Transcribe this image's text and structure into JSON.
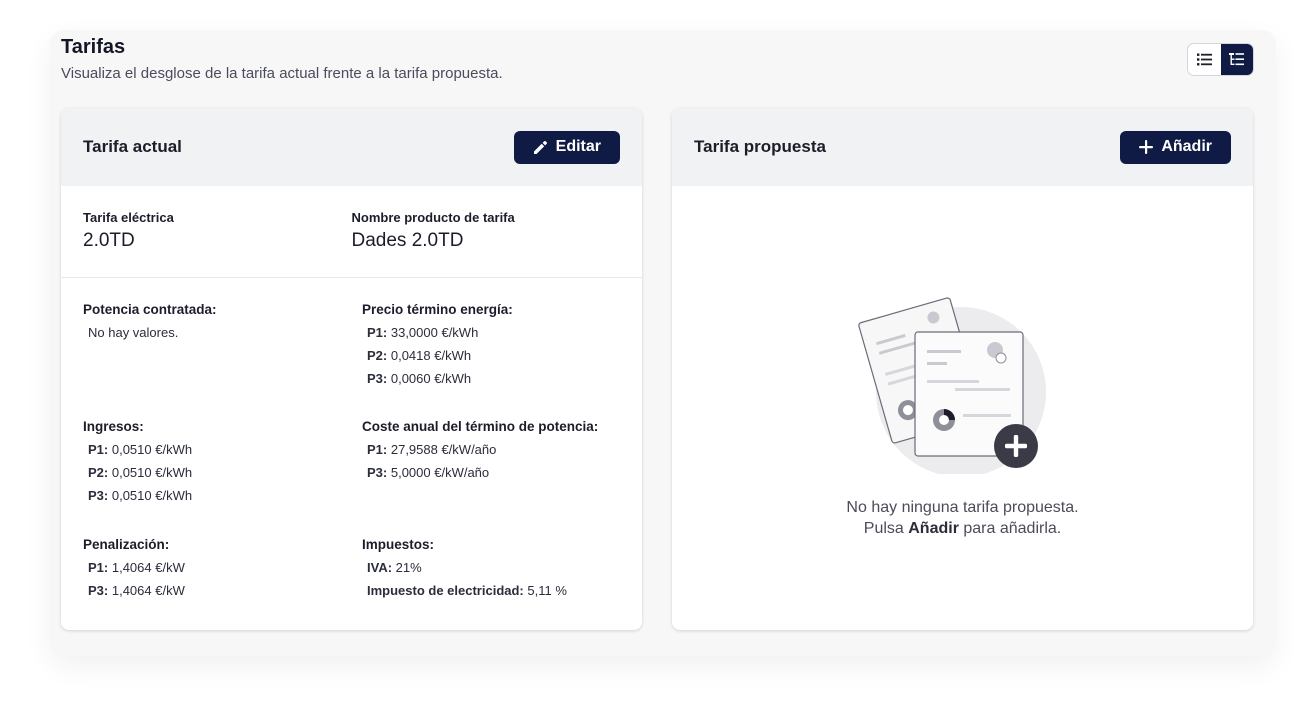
{
  "header": {
    "title": "Tarifas",
    "subtitle": "Visualiza el desglose de la tarifa actual frente a la tarifa propuesta."
  },
  "view_toggle": {
    "options": [
      "list-icon",
      "tree-list-icon"
    ],
    "active": "tree-list-icon"
  },
  "current": {
    "title": "Tarifa actual",
    "edit_label": "Editar",
    "tarifa_label": "Tarifa eléctrica",
    "tarifa_value": "2.0TD",
    "producto_label": "Nombre producto de tarifa",
    "producto_value": "Dades 2.0TD",
    "potencia": {
      "title": "Potencia contratada:",
      "empty": "No hay valores."
    },
    "energia": {
      "title": "Precio término energía:",
      "rows": [
        {
          "k": "P1:",
          "v": "33,0000 €/kWh"
        },
        {
          "k": "P2:",
          "v": "0,0418 €/kWh"
        },
        {
          "k": "P3:",
          "v": "0,0060 €/kWh"
        }
      ]
    },
    "ingresos": {
      "title": "Ingresos:",
      "rows": [
        {
          "k": "P1:",
          "v": "0,0510 €/kWh"
        },
        {
          "k": "P2:",
          "v": "0,0510 €/kWh"
        },
        {
          "k": "P3:",
          "v": "0,0510 €/kWh"
        }
      ]
    },
    "coste": {
      "title": "Coste anual del término de potencia:",
      "rows": [
        {
          "k": "P1:",
          "v": "27,9588 €/kW/año"
        },
        {
          "k": "P3:",
          "v": "5,0000 €/kW/año"
        }
      ]
    },
    "penalizacion": {
      "title": "Penalización:",
      "rows": [
        {
          "k": "P1:",
          "v": "1,4064 €/kW"
        },
        {
          "k": "P3:",
          "v": "1,4064 €/kW"
        }
      ]
    },
    "impuestos": {
      "title": "Impuestos:",
      "rows": [
        {
          "k": "IVA:",
          "v": "21%"
        },
        {
          "k": "Impuesto de electricidad:",
          "v": "5,11 %"
        }
      ]
    }
  },
  "proposed": {
    "title": "Tarifa propuesta",
    "add_label": "Añadir",
    "empty_line1": "No hay ninguna tarifa propuesta.",
    "empty_pre": "Pulsa",
    "empty_bold": "Añadir",
    "empty_post": "para añadirla."
  }
}
